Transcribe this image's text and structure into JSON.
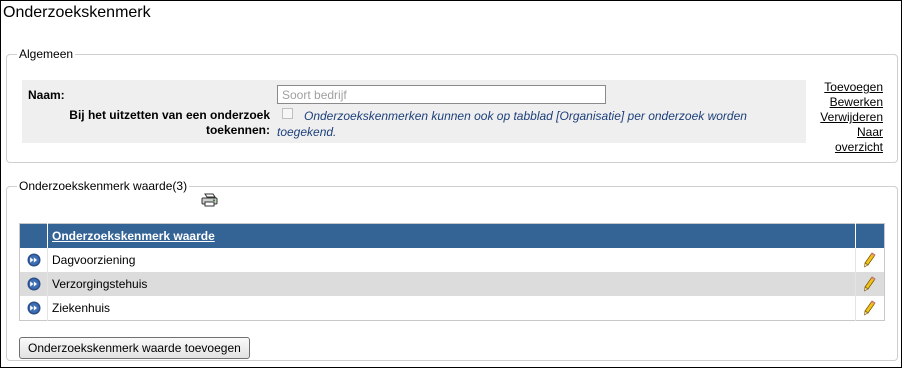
{
  "page": {
    "title": "Onderzoekskenmerk"
  },
  "general": {
    "legend": "Algemeen",
    "name_label": "Naam:",
    "name_placeholder": "Soort bedrijf",
    "assign_label": "Bij het uitzetten van een onderzoek toekennen:",
    "assign_checked": false,
    "assign_hint": "Onderzoekskenmerken kunnen ook op tabblad [Organisatie] per onderzoek worden toegekend."
  },
  "actions": {
    "add": "Toevoegen",
    "edit": "Bewerken",
    "delete": "Verwijderen",
    "overview": "Naar overzicht"
  },
  "values_section": {
    "legend": "Onderzoekskenmerk waarde(3)",
    "column_header": "Onderzoekskenmerk waarde",
    "rows": [
      "Dagvoorziening",
      "Verzorgingstehuis",
      "Ziekenhuis"
    ],
    "add_button": "Onderzoekskenmerk waarde toevoegen"
  },
  "colors": {
    "header_bg": "#346495",
    "alt_row_bg": "#dcdcdc",
    "hint_text": "#1c3f7a"
  },
  "icons": {
    "row_open": "arrow-right-circle-icon",
    "row_edit": "pencil-icon",
    "print": "printer-icon"
  }
}
